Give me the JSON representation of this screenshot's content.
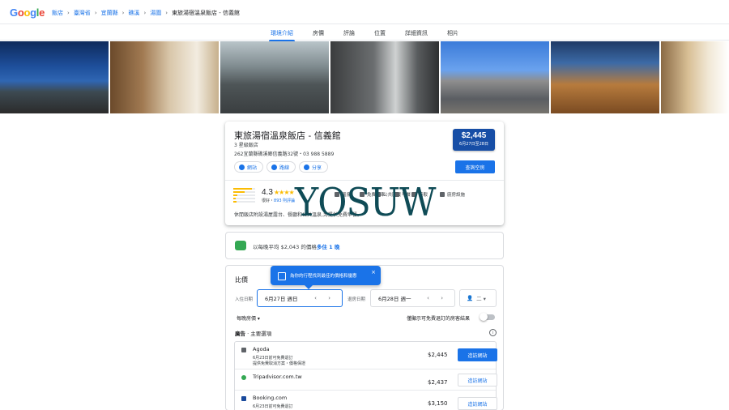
{
  "header": {
    "logo_letters": [
      {
        "ch": "G",
        "color": "#4285f4"
      },
      {
        "ch": "o",
        "color": "#ea4335"
      },
      {
        "ch": "o",
        "color": "#fbbc05"
      },
      {
        "ch": "g",
        "color": "#4285f4"
      },
      {
        "ch": "l",
        "color": "#34a853"
      },
      {
        "ch": "e",
        "color": "#ea4335"
      }
    ],
    "breadcrumbs": [
      "飯店",
      "臺灣省",
      "宜蘭縣",
      "礁溪",
      "湯圍"
    ],
    "breadcrumb_sep": "›",
    "current": "東旅湯宿溫泉飯店 - 信義館"
  },
  "tabs": [
    {
      "label": "環境介紹",
      "active": true
    },
    {
      "label": "房價",
      "active": false
    },
    {
      "label": "評論",
      "active": false
    },
    {
      "label": "位置",
      "active": false
    },
    {
      "label": "詳細資訊",
      "active": false
    },
    {
      "label": "相片",
      "active": false
    }
  ],
  "photos": [
    {
      "name": "photo-exterior-night",
      "bg": "linear-gradient(180deg,#0e2a5c 0%,#1e4f9b 35%,#2f66b3 55%,#3d4a52 70%,#2b2b2b 100%)"
    },
    {
      "name": "photo-bedroom",
      "bg": "linear-gradient(90deg,#6b4a2b 0%,#a17a52 30%,#d9c7aa 55%,#f2ece0 80%,#c7b08c 100%)"
    },
    {
      "name": "photo-bath-stone",
      "bg": "linear-gradient(180deg,#b9c4c9 0%,#7f8b8f 35%,#4e5557 60%,#3a3e40 100%)"
    },
    {
      "name": "photo-shower",
      "bg": "linear-gradient(90deg,#3b3d3e 0%,#6b6e70 40%,#cfd2d2 60%,#595c5e 80%,#2e3031 100%)"
    },
    {
      "name": "photo-exterior-day",
      "bg": "linear-gradient(180deg,#3b7bd9 0%,#6aa2ee 40%,#8e8e8e 55%,#5a5d62 80%,#77746e 100%)"
    },
    {
      "name": "photo-restaurant",
      "bg": "linear-gradient(180deg,#1f3a66 0%,#3c6aa6 30%,#b77b3d 60%,#7a4b22 100%)"
    },
    {
      "name": "photo-room-lamp",
      "bg": "linear-gradient(90deg,#8a6a45 0%,#d8bf95 40%,#f1e8d6 70%,#ffffff 100%)"
    }
  ],
  "hotel": {
    "name": "東旅湯宿溫泉飯店 - 信義館",
    "class": "3 星級飯店",
    "address": "262宜蘭縣礁溪鄉信義路32號・03 988 5889",
    "actions": [
      "網站",
      "路線",
      "分享"
    ],
    "price": "$2,445",
    "price_dates": "6月27日至28日",
    "avail_button": "查詢空房",
    "rating": "4.3",
    "stars": "★★★★",
    "review_prefix": "很好",
    "review_link": "893 則評論",
    "rating_bars": [
      0.85,
      0.5,
      0.2,
      0.1,
      0.15
    ],
    "features": [
      "溫泉",
      "免費停車",
      "公共區域",
      "早餐",
      "接駁",
      "廚房設施"
    ],
    "description": "休閒飯店附設湯屋露台、餐廳和公共溫泉,另提供免費早餐。"
  },
  "watermark": "YOSUW",
  "tip": {
    "prefix": "以每晚平均 $2,043 的價格",
    "bold": "多住 1 晚"
  },
  "compare": {
    "title": "比價",
    "tooltip": "為你的行程找到最佳的價格和優惠",
    "tooltip_close": "×",
    "checkin_label": "入住日期",
    "checkin": "6月27日 週日",
    "checkout_label": "退房日期",
    "checkout": "6月28日 週一",
    "arrows": "‹ ›",
    "guests": "二 ▾",
    "per_room": "每晚房價 ▾",
    "free_cancel": "僅顯示可免費退訂的房客結果",
    "ads_label": "廣告",
    "ads_rest": " · 主要選項",
    "info": "i",
    "offers": [
      {
        "name": "Agoda",
        "l1": "6月23日前可免費退訂",
        "l2": "提供免費取消方案・價格保證",
        "price": "$2,445",
        "btn": "造訪網站",
        "primary": true,
        "color": "#5f6368"
      },
      {
        "name": "Tripadvisor.com.tw",
        "l1": "",
        "l2": "",
        "price": "$2,437",
        "btn": "造訪網站",
        "primary": false,
        "color": "#34a853"
      },
      {
        "name": "Booking.com",
        "l1": "6月23日前可免費退訂",
        "l2": "",
        "price": "$3,150",
        "btn": "造訪網站",
        "primary": false,
        "color": "#1a4a9c"
      }
    ]
  }
}
